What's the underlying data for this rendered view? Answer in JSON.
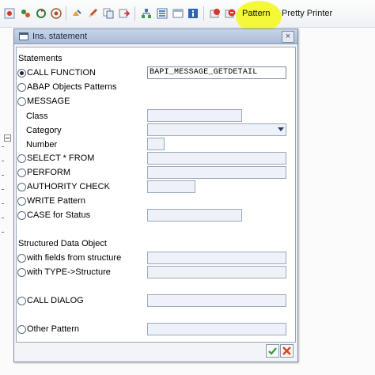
{
  "toolbar": {
    "pattern_label": "Pattern",
    "pretty_printer_label": "Pretty Printer",
    "highlight_color": "#f4f72a",
    "icons": [
      "where-used-icon",
      "activate-icon",
      "cycle-icon",
      "display-object-icon",
      "other-object-icon",
      "edit-icon",
      "copy-icon",
      "transport-icon",
      "hierarchy-icon",
      "list-icon",
      "frame-icon",
      "info-icon",
      "breakpoint-icon",
      "session-breakpoint-icon"
    ]
  },
  "dialog": {
    "title": "Ins. statement",
    "close_symbol": "×",
    "statements_heading": "Statements",
    "structured_heading": "Structured Data Object",
    "call_function_label": "CALL FUNCTION",
    "call_function_value": "BAPI_MESSAGE_GETDETAIL",
    "abap_objects_label": "ABAP Objects Patterns",
    "message_label": "MESSAGE",
    "class_label": "Class",
    "category_label": "Category",
    "number_label": "Number",
    "select_label": "SELECT * FROM",
    "perform_label": "PERFORM",
    "authority_label": "AUTHORITY CHECK",
    "write_label": "WRITE Pattern",
    "case_label": "CASE for Status",
    "fields_from_structure_label": "with fields from structure",
    "type_structure_label": "with TYPE->Structure",
    "call_dialog_label": "CALL DIALOG",
    "other_pattern_label": "Other Pattern",
    "selected_option": "CALL FUNCTION",
    "ok_icon": "checkmark-icon",
    "cancel_icon": "cancel-x-icon",
    "colors": {
      "ok": "#3aa63a",
      "cancel": "#d44b1f",
      "title_bg": "#b9cae3"
    }
  }
}
